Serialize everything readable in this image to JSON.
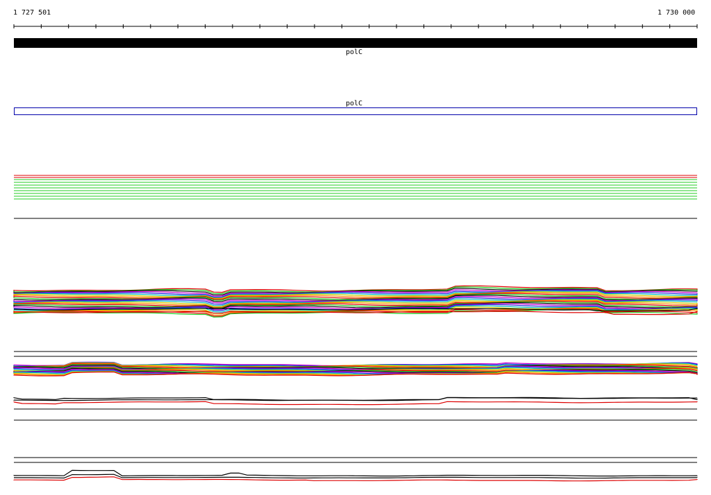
{
  "ruler": {
    "start_label": "1 727 501",
    "end_label": "1 730 000",
    "tick_count": 25
  },
  "gene_track": {
    "label": "polC"
  },
  "cds_track": {
    "label": "polC",
    "outline_color": "#0000aa"
  },
  "colors": {
    "red": "#dd0000",
    "green": "#22cc22",
    "black": "#000000",
    "magenta": "#cc00cc",
    "blue": "#2222dd",
    "cyan": "#00bbbb",
    "yellow": "#cccc00",
    "orange": "#ff8800"
  }
}
